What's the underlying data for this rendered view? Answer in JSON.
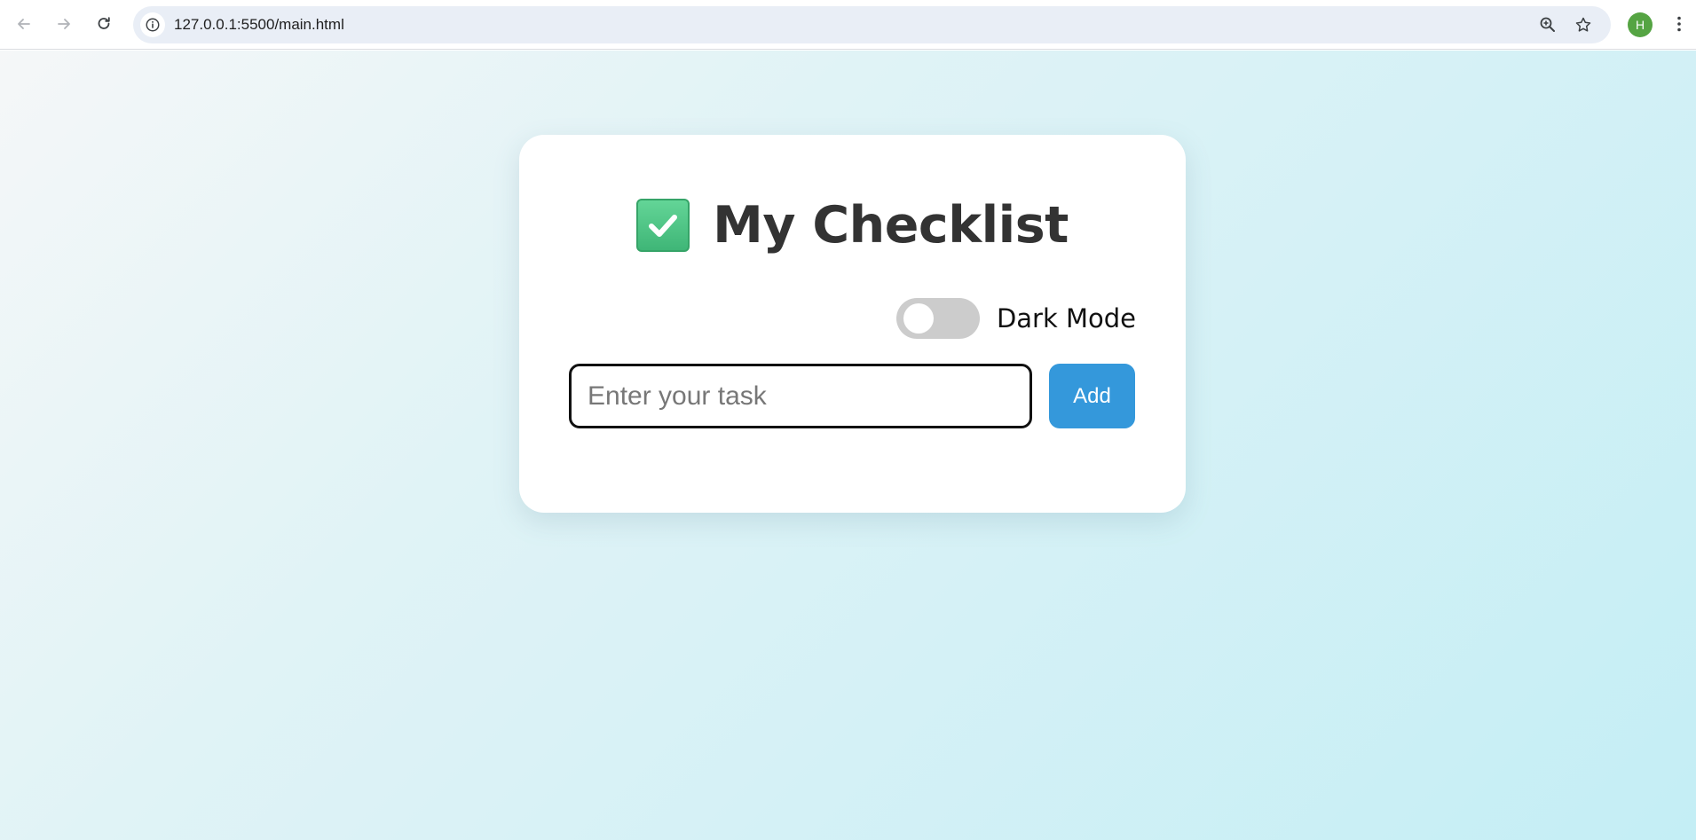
{
  "browser": {
    "url": "127.0.0.1:5500/main.html",
    "profile_initial": "H",
    "profile_color": "#55a443"
  },
  "page": {
    "title": "My Checklist",
    "title_icon": "check-mark-button-emoji",
    "dark_mode": {
      "label": "Dark Mode",
      "enabled": false
    },
    "task_input": {
      "value": "",
      "placeholder": "Enter your task"
    },
    "add_button": {
      "label": "Add"
    },
    "tasks": []
  },
  "colors": {
    "accent": "#3498db",
    "title": "#333333",
    "toggle_off": "#cccccc",
    "check_green": "#4cc485"
  }
}
